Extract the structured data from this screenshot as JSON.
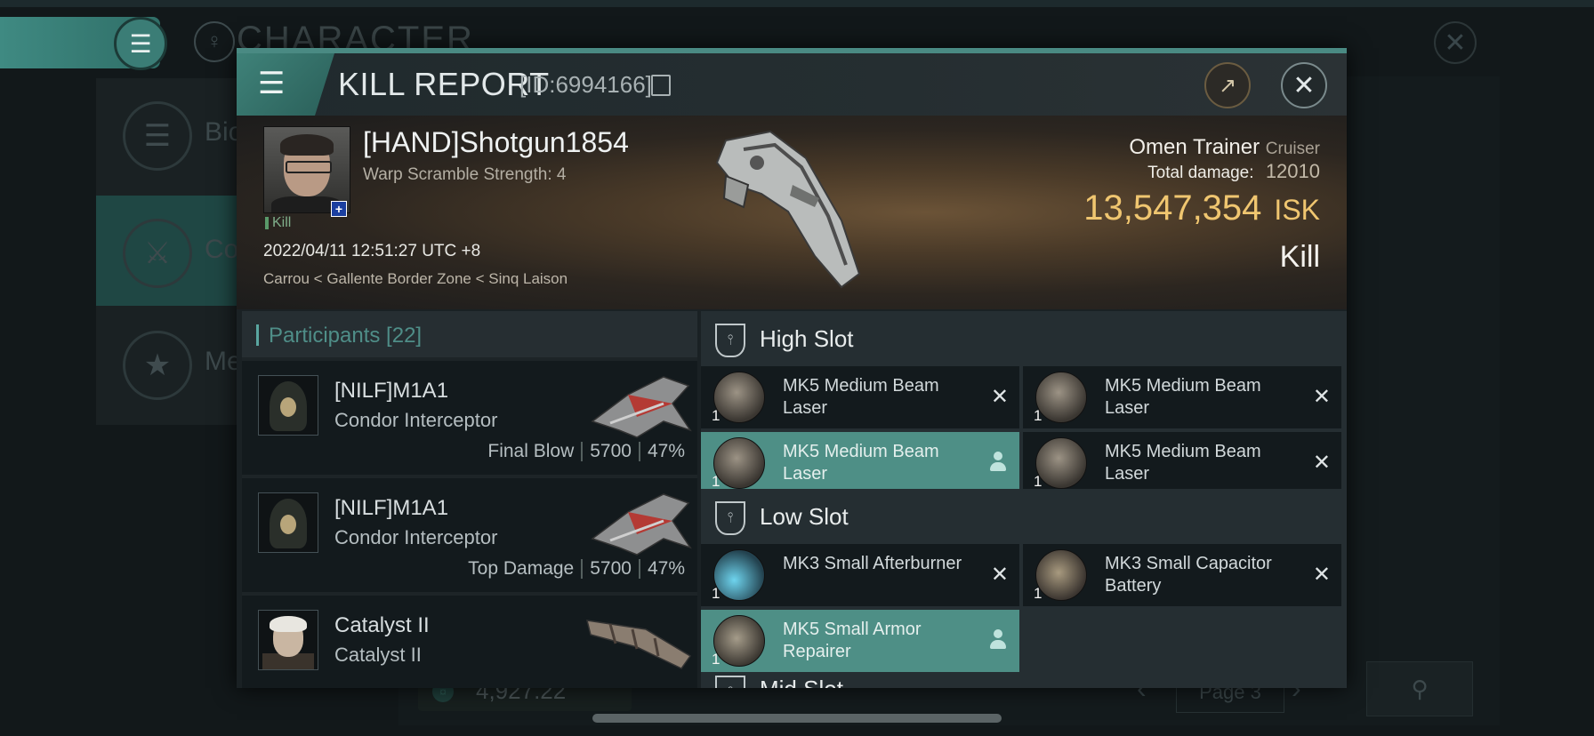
{
  "background": {
    "page_title": "CHARACTER",
    "side_items": [
      {
        "label": "Bio"
      },
      {
        "label": "Co"
      },
      {
        "label": "Me"
      }
    ],
    "bottom_value": "4,927.22",
    "page_label": "Page 3"
  },
  "dialog": {
    "title": "KILL REPORT",
    "id_label": "[ID:6994166]"
  },
  "victim": {
    "name": "[HAND]Shotgun1854",
    "warp_scramble": "Warp Scramble Strength: 4",
    "result_tag": "Kill",
    "datetime": "2022/04/11 12:51:27 UTC +8",
    "location": "Carrou < Gallente Border Zone < Sinq Laison",
    "ship_name": "Omen Trainer",
    "ship_class": "Cruiser",
    "total_damage_label": "Total damage:",
    "total_damage": "12010",
    "isk_value": "13,547,354",
    "isk_unit": "ISK",
    "result": "Kill"
  },
  "participants": {
    "header": "Participants [22]",
    "rows": [
      {
        "name": "[NILF]M1A1",
        "ship": "Condor Interceptor",
        "tag": "Final Blow",
        "damage": "5700",
        "percent": "47%"
      },
      {
        "name": "[NILF]M1A1",
        "ship": "Condor Interceptor",
        "tag": "Top Damage",
        "damage": "5700",
        "percent": "47%"
      },
      {
        "name": "Catalyst II",
        "ship": "Catalyst II",
        "tag": "",
        "damage": "",
        "percent": ""
      }
    ]
  },
  "fittings": {
    "high_slot_label": "High Slot",
    "low_slot_label": "Low Slot",
    "mid_slot_label": "Mid Slot",
    "high_slot": [
      {
        "name": "MK5 Medium Beam Laser",
        "qty": "1",
        "state": "destroyed"
      },
      {
        "name": "MK5 Medium Beam Laser",
        "qty": "1",
        "state": "destroyed"
      },
      {
        "name": "MK5 Medium Beam Laser",
        "qty": "1",
        "state": "dropped"
      },
      {
        "name": "MK5 Medium Beam Laser",
        "qty": "1",
        "state": "destroyed"
      }
    ],
    "low_slot": [
      {
        "name": "MK3 Small Afterburner",
        "qty": "1",
        "state": "destroyed"
      },
      {
        "name": "MK3 Small Capacitor Battery",
        "qty": "1",
        "state": "destroyed"
      },
      {
        "name": "MK5 Small Armor Repairer",
        "qty": "1",
        "state": "dropped"
      }
    ]
  }
}
